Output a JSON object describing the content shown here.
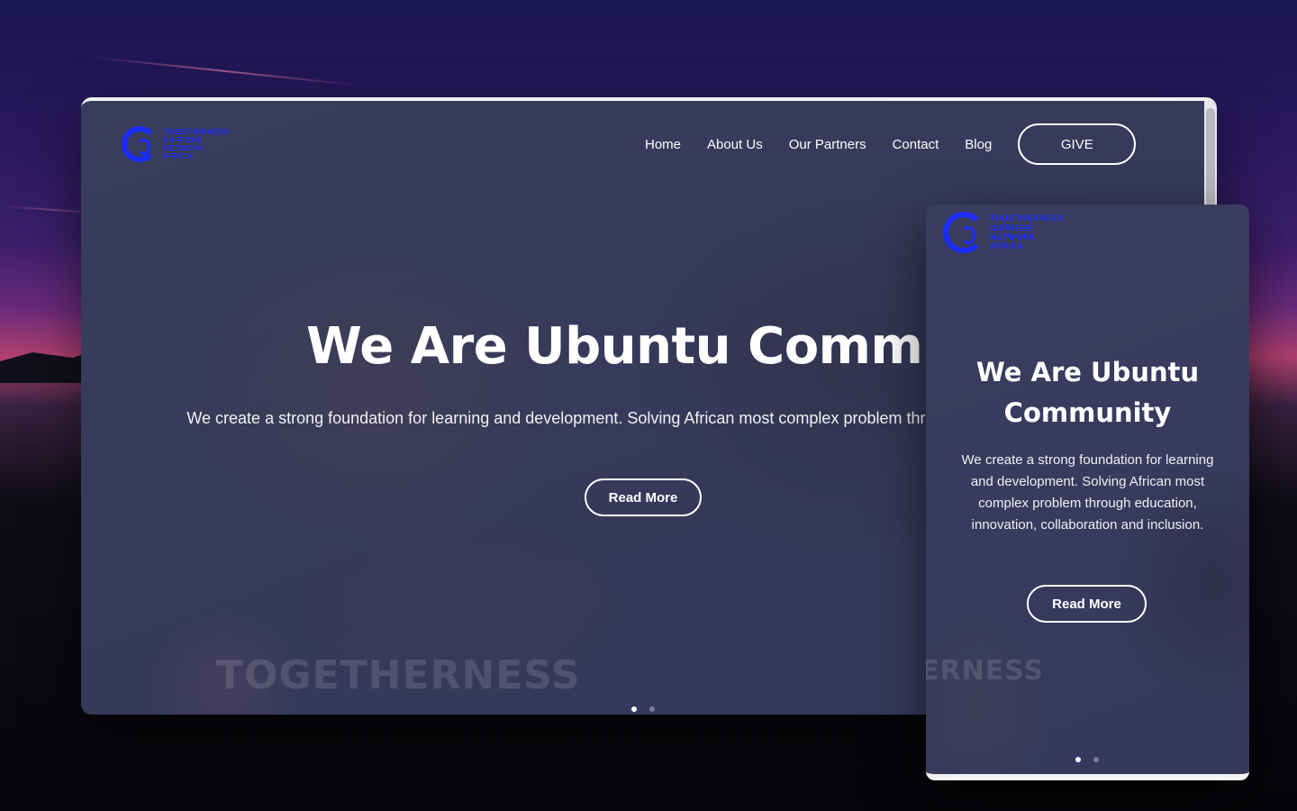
{
  "org": {
    "logo_lines": [
      "TOGETHERNESS",
      "SUPREME",
      "NETWORK",
      "AFRICA"
    ]
  },
  "nav": {
    "items": [
      "Home",
      "About Us",
      "Our Partners",
      "Contact",
      "Blog"
    ],
    "give_label": "GIVE"
  },
  "hero": {
    "desktop_title": "We Are Ubuntu Communi",
    "desktop_subtitle": "We create a strong foundation for learning and development. Solving African most complex problem through edu and inclusion.",
    "mobile_title_line1": "We Are Ubuntu",
    "mobile_title_line2": "Community",
    "mobile_subtitle": "We create a strong foundation for learning and development. Solving African most complex problem through education, innovation, collaboration and inclusion.",
    "read_more_label": "Read More",
    "watermark_desktop": "TOGETHERNESS",
    "watermark_mobile": "ERNESS"
  },
  "carousel": {
    "slides": 2,
    "active_index": 0
  },
  "colors": {
    "brand_blue": "#1a2cff",
    "overlay": "#373a5c",
    "text": "#ffffff"
  }
}
